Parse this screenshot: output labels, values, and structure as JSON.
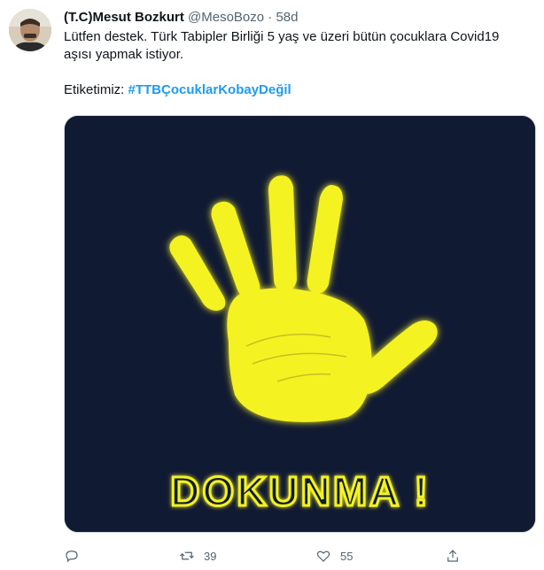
{
  "tweet": {
    "display_name": "(T.C)Mesut Bozkurt",
    "handle": "@MesoBozo",
    "separator": "·",
    "time": "58d",
    "text_line1": "Lütfen destek. Türk Tabipler Birliği 5 yaş ve üzeri bütün çocuklara Covid19 aşısı yapmak istiyor.",
    "tag_prefix": "Etiketimiz: ",
    "hashtag": "#TTBÇocuklarKobayDeğil",
    "image_caption": "DOKUNMA !"
  },
  "actions": {
    "reply_count": "",
    "retweet_count": "39",
    "like_count": "55"
  },
  "colors": {
    "accent": "#1d9bf0",
    "image_bg": "#111a33",
    "hand": "#f5f222"
  },
  "icons": [
    "reply-icon",
    "retweet-icon",
    "like-icon",
    "share-icon"
  ]
}
